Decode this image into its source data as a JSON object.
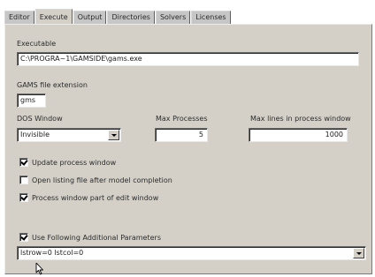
{
  "tabs": [
    {
      "label": "Editor",
      "active": false
    },
    {
      "label": "Execute",
      "active": true
    },
    {
      "label": "Output",
      "active": false
    },
    {
      "label": "Directories",
      "active": false
    },
    {
      "label": "Solvers",
      "active": false
    },
    {
      "label": "Licenses",
      "active": false
    }
  ],
  "executable": {
    "label": "Executable",
    "value": "C:\\PROGRA~1\\GAMSIDE\\gams.exe"
  },
  "extension": {
    "label": "GAMS file extension",
    "value": "gms"
  },
  "dos_window": {
    "label": "DOS Window",
    "value": "Invisible"
  },
  "max_processes": {
    "label": "Max Processes",
    "value": "5"
  },
  "max_lines": {
    "label": "Max lines in process window",
    "value": "1000"
  },
  "options": [
    {
      "label": "Update process window",
      "checked": true
    },
    {
      "label": "Open listing file after model completion",
      "checked": false
    },
    {
      "label": "Process window part of edit window",
      "checked": true
    }
  ],
  "additional_params": {
    "label": "Use Following Additional Parameters",
    "checked": true,
    "value": "lstrow=0 lstcol=0"
  },
  "icons": {
    "pointer": "mouse-pointer-icon",
    "dropdown": "chevron-down-icon"
  },
  "colors": {
    "panel": "#d4d0c8",
    "field": "#ffffff"
  }
}
